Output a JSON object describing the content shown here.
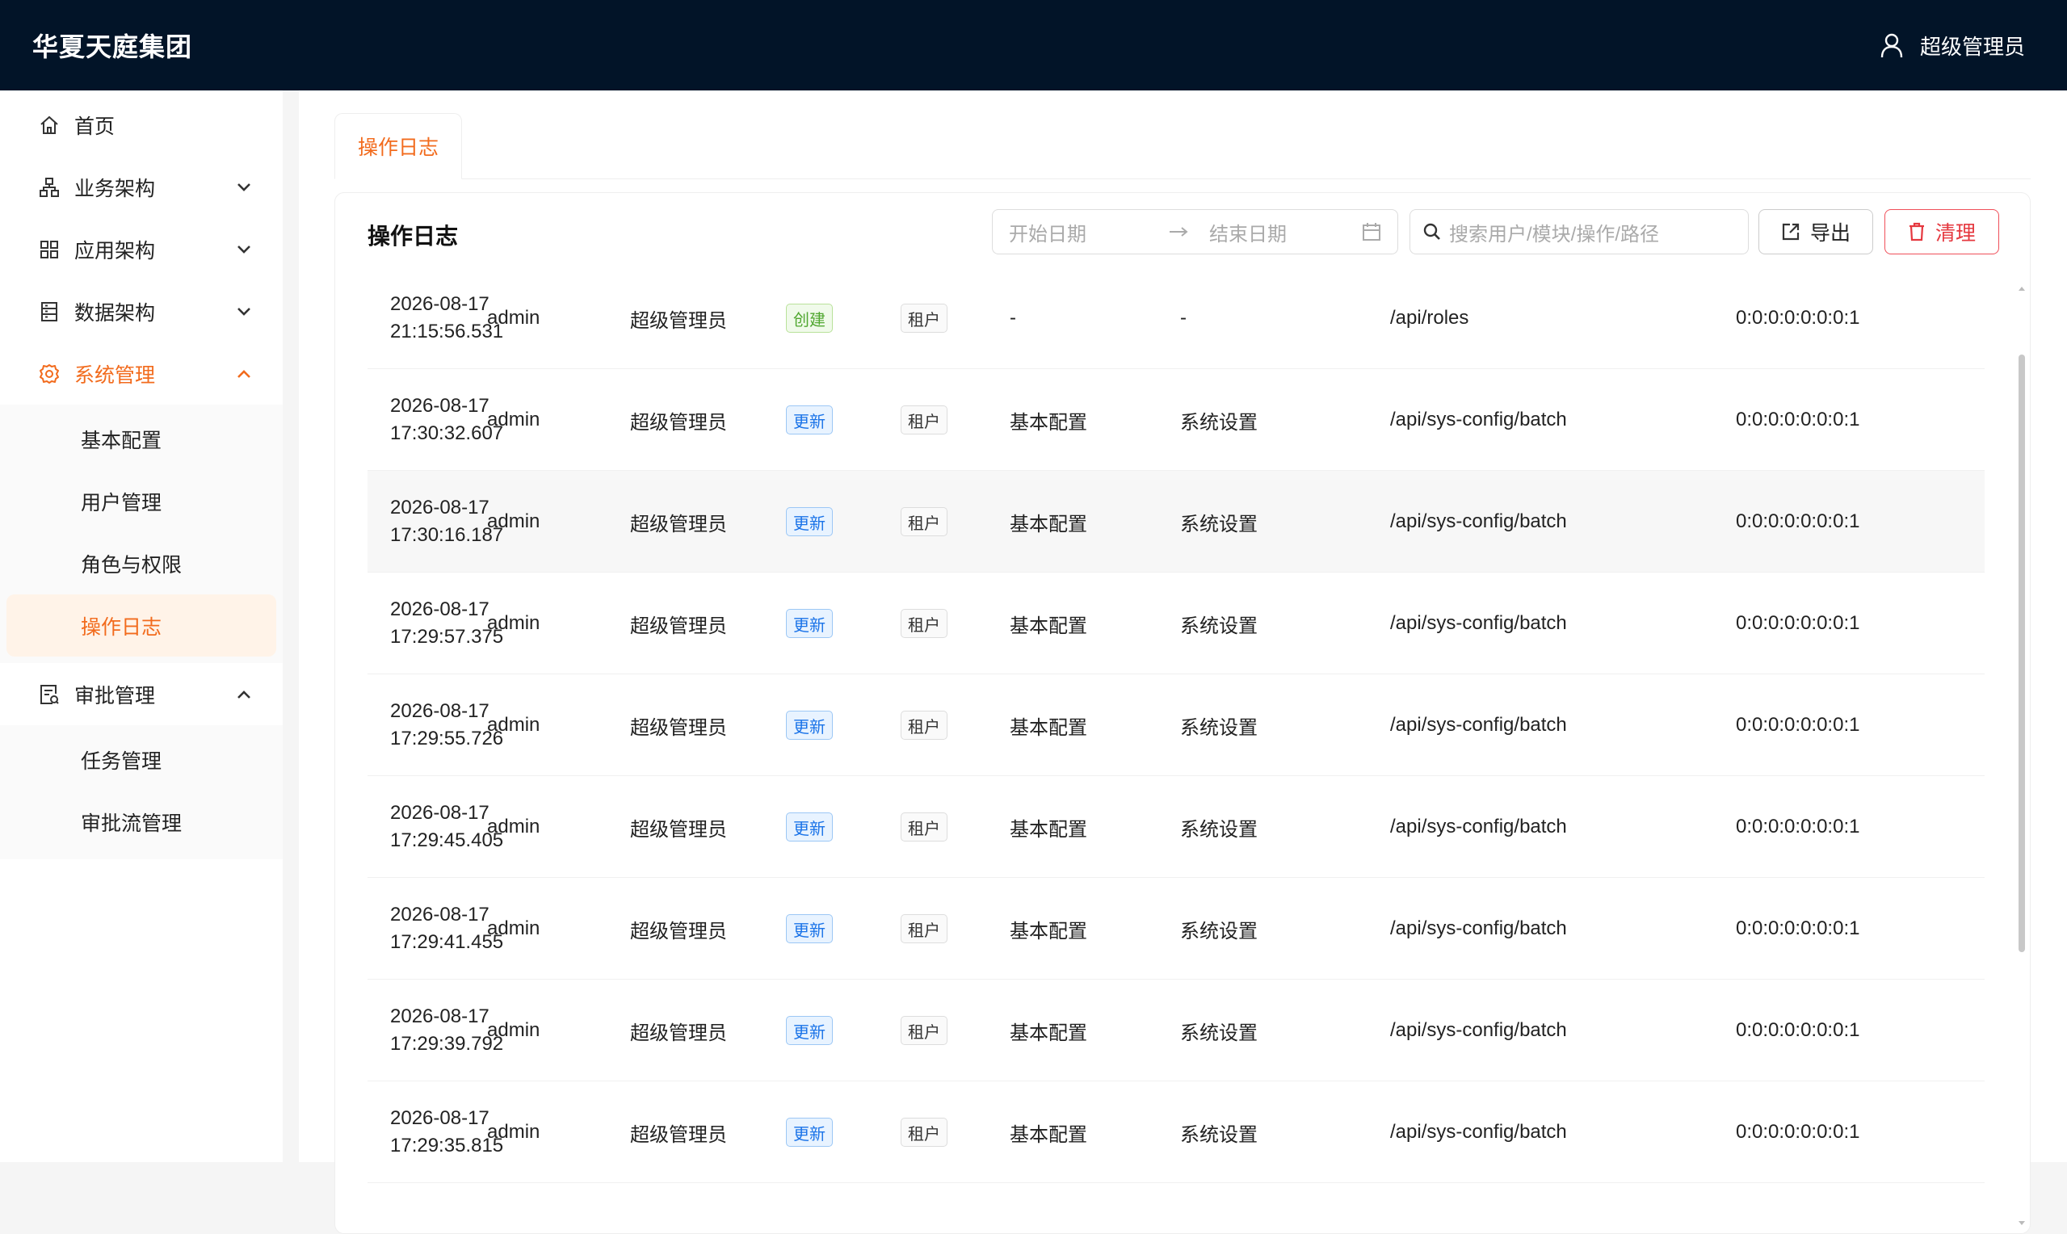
{
  "header": {
    "brand": "华夏天庭集团",
    "user_name": "超级管理员"
  },
  "sidebar": {
    "items": [
      {
        "label": "首页",
        "icon": "home-icon"
      },
      {
        "label": "业务架构",
        "icon": "org-chart-icon"
      },
      {
        "label": "应用架构",
        "icon": "grid-icon"
      },
      {
        "label": "数据架构",
        "icon": "database-icon"
      },
      {
        "label": "系统管理",
        "icon": "gear-icon"
      },
      {
        "label": "审批管理",
        "icon": "approval-icon"
      }
    ],
    "system_sub": [
      "基本配置",
      "用户管理",
      "角色与权限",
      "操作日志"
    ],
    "approval_sub": [
      "任务管理",
      "审批流管理"
    ]
  },
  "tabs": [
    {
      "label": "操作日志"
    }
  ],
  "card": {
    "title": "操作日志",
    "start_placeholder": "开始日期",
    "end_placeholder": "结束日期",
    "search_placeholder": "搜索用户/模块/操作/路径",
    "export_label": "导出",
    "clear_label": "清理"
  },
  "rows": [
    {
      "date": "2026-08-17",
      "time": "21:15:56.531",
      "user": "admin",
      "role": "超级管理员",
      "action": "创建",
      "scope": "租户",
      "module": "-",
      "operation": "-",
      "path": "/api/roles",
      "ip": "0:0:0:0:0:0:0:1"
    },
    {
      "date": "2026-08-17",
      "time": "17:30:32.607",
      "user": "admin",
      "role": "超级管理员",
      "action": "更新",
      "scope": "租户",
      "module": "基本配置",
      "operation": "系统设置",
      "path": "/api/sys-config/batch",
      "ip": "0:0:0:0:0:0:0:1"
    },
    {
      "date": "2026-08-17",
      "time": "17:30:16.187",
      "user": "admin",
      "role": "超级管理员",
      "action": "更新",
      "scope": "租户",
      "module": "基本配置",
      "operation": "系统设置",
      "path": "/api/sys-config/batch",
      "ip": "0:0:0:0:0:0:0:1"
    },
    {
      "date": "2026-08-17",
      "time": "17:29:57.375",
      "user": "admin",
      "role": "超级管理员",
      "action": "更新",
      "scope": "租户",
      "module": "基本配置",
      "operation": "系统设置",
      "path": "/api/sys-config/batch",
      "ip": "0:0:0:0:0:0:0:1"
    },
    {
      "date": "2026-08-17",
      "time": "17:29:55.726",
      "user": "admin",
      "role": "超级管理员",
      "action": "更新",
      "scope": "租户",
      "module": "基本配置",
      "operation": "系统设置",
      "path": "/api/sys-config/batch",
      "ip": "0:0:0:0:0:0:0:1"
    },
    {
      "date": "2026-08-17",
      "time": "17:29:45.405",
      "user": "admin",
      "role": "超级管理员",
      "action": "更新",
      "scope": "租户",
      "module": "基本配置",
      "operation": "系统设置",
      "path": "/api/sys-config/batch",
      "ip": "0:0:0:0:0:0:0:1"
    },
    {
      "date": "2026-08-17",
      "time": "17:29:41.455",
      "user": "admin",
      "role": "超级管理员",
      "action": "更新",
      "scope": "租户",
      "module": "基本配置",
      "operation": "系统设置",
      "path": "/api/sys-config/batch",
      "ip": "0:0:0:0:0:0:0:1"
    },
    {
      "date": "2026-08-17",
      "time": "17:29:39.792",
      "user": "admin",
      "role": "超级管理员",
      "action": "更新",
      "scope": "租户",
      "module": "基本配置",
      "operation": "系统设置",
      "path": "/api/sys-config/batch",
      "ip": "0:0:0:0:0:0:0:1"
    },
    {
      "date": "2026-08-17",
      "time": "17:29:35.815",
      "user": "admin",
      "role": "超级管理员",
      "action": "更新",
      "scope": "租户",
      "module": "基本配置",
      "operation": "系统设置",
      "path": "/api/sys-config/batch",
      "ip": "0:0:0:0:0:0:0:1"
    }
  ],
  "colors": {
    "header_bg": "#021428",
    "accent": "#f26b1d",
    "danger": "#e5383f",
    "create_tag": "#52a832",
    "update_tag": "#1a73e8"
  }
}
